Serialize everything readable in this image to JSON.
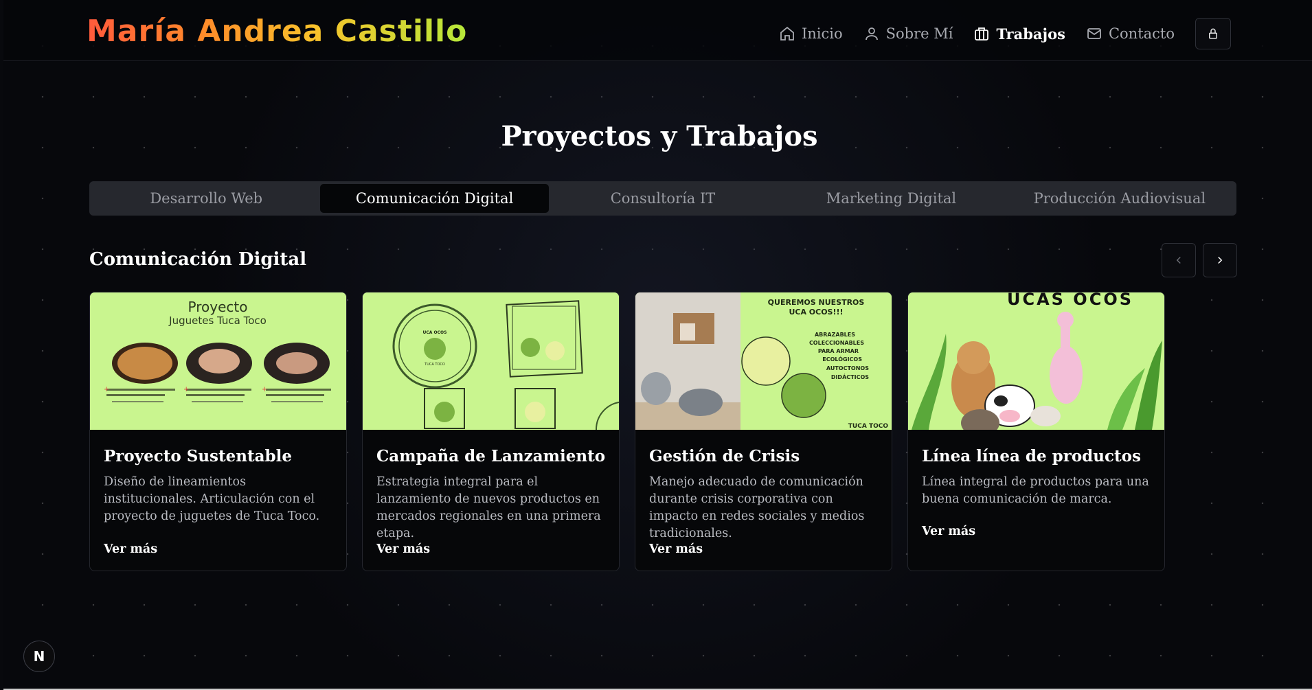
{
  "header": {
    "logo": "María Andrea Castillo",
    "nav": [
      {
        "label": "Inicio",
        "icon": "home-icon"
      },
      {
        "label": "Sobre Mí",
        "icon": "user-icon"
      },
      {
        "label": "Trabajos",
        "icon": "briefcase-icon",
        "active": true
      },
      {
        "label": "Contacto",
        "icon": "mail-icon"
      }
    ],
    "lock_icon": "lock-icon"
  },
  "page_title": "Proyectos y Trabajos",
  "tabs": [
    {
      "label": "Desarrollo Web"
    },
    {
      "label": "Comunicación Digital",
      "active": true
    },
    {
      "label": "Consultoría IT"
    },
    {
      "label": "Marketing Digital"
    },
    {
      "label": "Producción Audiovisual"
    }
  ],
  "section_title": "Comunicación Digital",
  "cards": [
    {
      "title": "Proyecto Sustentable",
      "description": "Diseño de lineamientos institucionales. Articulación con el proyecto de juguetes de Tuca Toco.",
      "more": "Ver más",
      "image": {
        "heading": "Proyecto",
        "subheading": "Juguetes Tuca Toco"
      }
    },
    {
      "title": "Campaña de Lanzamiento",
      "description": "Estrategia integral para el lanzamiento de nuevos productos en mercados regionales en una primera etapa.",
      "more": "Ver más",
      "image": {
        "logo_top": "UCA OCOS",
        "logo_bottom": "TUCA TOCO"
      }
    },
    {
      "title": "Gestión de Crisis",
      "description": "Manejo adecuado de comunicación durante crisis corporativa con impacto en redes sociales y medios tradicionales.",
      "more": "Ver más",
      "image": {
        "heading": "QUEREMOS NUESTROS UCA OCOS!!!",
        "list": [
          "ABRAZABLES",
          "COLECCIONABLES",
          "PARA ARMAR",
          "ECOLÓGICOS",
          "AUTOCTONOS",
          "DIDÁCTICOS"
        ],
        "footer": "TUCA TOCO"
      }
    },
    {
      "title": "Línea línea de productos",
      "description": "Línea integral de productos para una buena comunicación de marca.",
      "more": "Ver más",
      "image": {
        "heading": "UCAS OCOS"
      }
    }
  ],
  "colors": {
    "accent_green": "#c9f58f",
    "background": "#07080c"
  },
  "dev_badge": "N"
}
